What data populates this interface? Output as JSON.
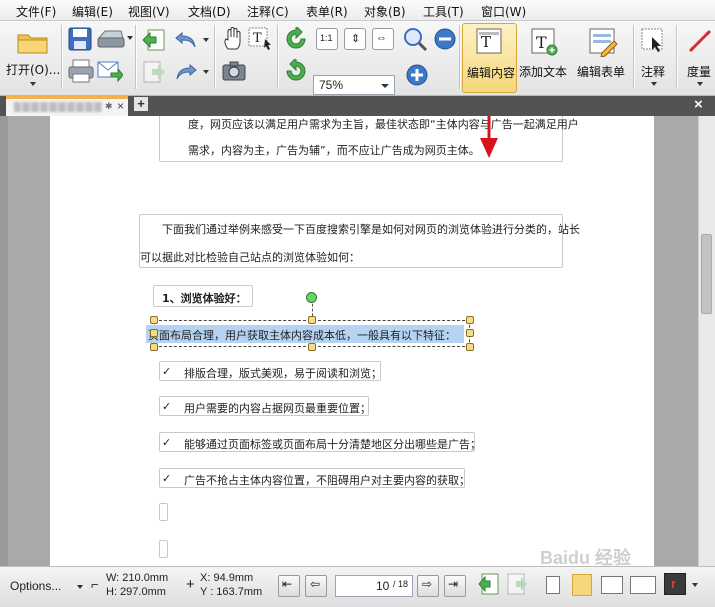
{
  "menu": [
    "文件(F)",
    "编辑(E)",
    "视图(V)",
    "文档(D)",
    "注释(C)",
    "表单(R)",
    "对象(B)",
    "工具(T)",
    "窗口(W)"
  ],
  "toolbar": {
    "open_label": "打开(O)...",
    "zoom_value": "75%",
    "edit_content_label": "编辑内容",
    "add_text_label": "添加文本",
    "edit_form_label": "编辑表单",
    "annotate_label": "注释",
    "measure_label": "度量"
  },
  "tabs": {
    "active_tab_name": ""
  },
  "document": {
    "box1_line1": "度，网页应该以满足用户需求为主旨，最佳状态即“主体内容与广告一起满足用户",
    "box1_line2": "需求，内容为主，广告为辅”，而不应让广告成为网页主体。",
    "box2_line1": "下面我们通过举例来感受一下百度搜索引擎是如何对网页的浏览体验进行分类的，站长",
    "box2_line2": "可以据此对比检验自己站点的浏览体验如何：",
    "heading": "1、浏览体验好：",
    "selected_line": "页面布局合理，用户获取主体内容成本低，一般具有以下特征：",
    "check_items": [
      "排版合理，版式美观，易于阅读和浏览；",
      "用户需要的内容占据网页最重要位置；",
      "能够通过页面标签或页面布局十分清楚地区分出哪些是广告；",
      "广告不抢占主体内容位置，不阻碍用户对主要内容的获取；"
    ],
    "check_mark": "✓"
  },
  "statusbar": {
    "options_label": "Options...",
    "width": "W: 210.0mm",
    "height": "H: 297.0mm",
    "x": "X:   94.9mm",
    "y": "Y : 163.7mm",
    "page_current": "10",
    "page_total": "/ 18"
  },
  "watermark": "Baidu 经验",
  "colors": {
    "accent_arrow": "#d8141b",
    "selection": "#b5d3f3",
    "active_button": "#f6d77a",
    "green_handle": "#6fd167"
  }
}
